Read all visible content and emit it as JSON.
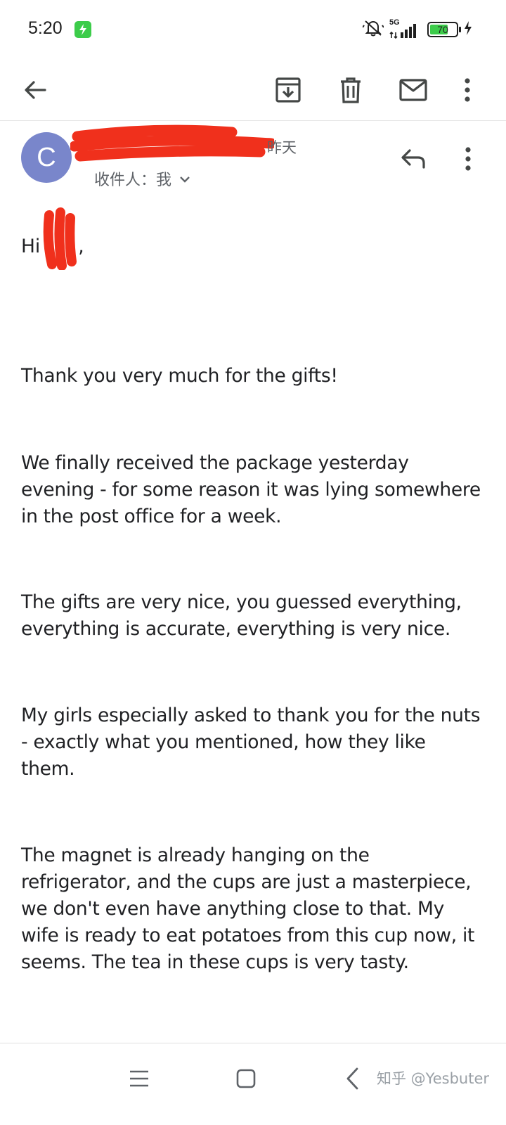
{
  "status_bar": {
    "time": "5:20",
    "network": "5G",
    "battery_level": "70",
    "battery_fraction": 0.7,
    "icons": [
      "charging-badge-icon",
      "mute-icon",
      "signal-icon",
      "battery-icon",
      "bolt-icon"
    ],
    "accent_green": "#3ccc4a"
  },
  "toolbar": {
    "icons": [
      "back-arrow-icon",
      "archive-icon",
      "trash-icon",
      "mail-icon",
      "more-vert-icon"
    ]
  },
  "message_header": {
    "avatar_letter": "C",
    "avatar_color": "#7986cb",
    "date": "昨天",
    "recipient_label": "收件人：我",
    "redaction_color": "#f0301c"
  },
  "body": {
    "greeting": "Hi",
    "greeting_suffix": ",",
    "paragraphs": [
      "Thank you very much for the gifts!",
      "We finally received the package yesterday evening - for some reason it was lying somewhere in the post office for a week.",
      "The gifts are very nice, you guessed everything, everything is accurate, everything is very nice.",
      "My girls especially asked to thank you for the nuts - exactly what you mentioned, how they like them.",
      "The magnet is already hanging on the refrigerator, and the cups are just a masterpiece, we don't even have anything close to that. My wife is ready to eat potatoes from this cup now, it seems. The tea in these cups is very tasty."
    ]
  },
  "nav_bar": {
    "icons": [
      "menu-icon",
      "home-icon",
      "back-icon"
    ],
    "watermark": "知乎 @Yesbuter"
  }
}
